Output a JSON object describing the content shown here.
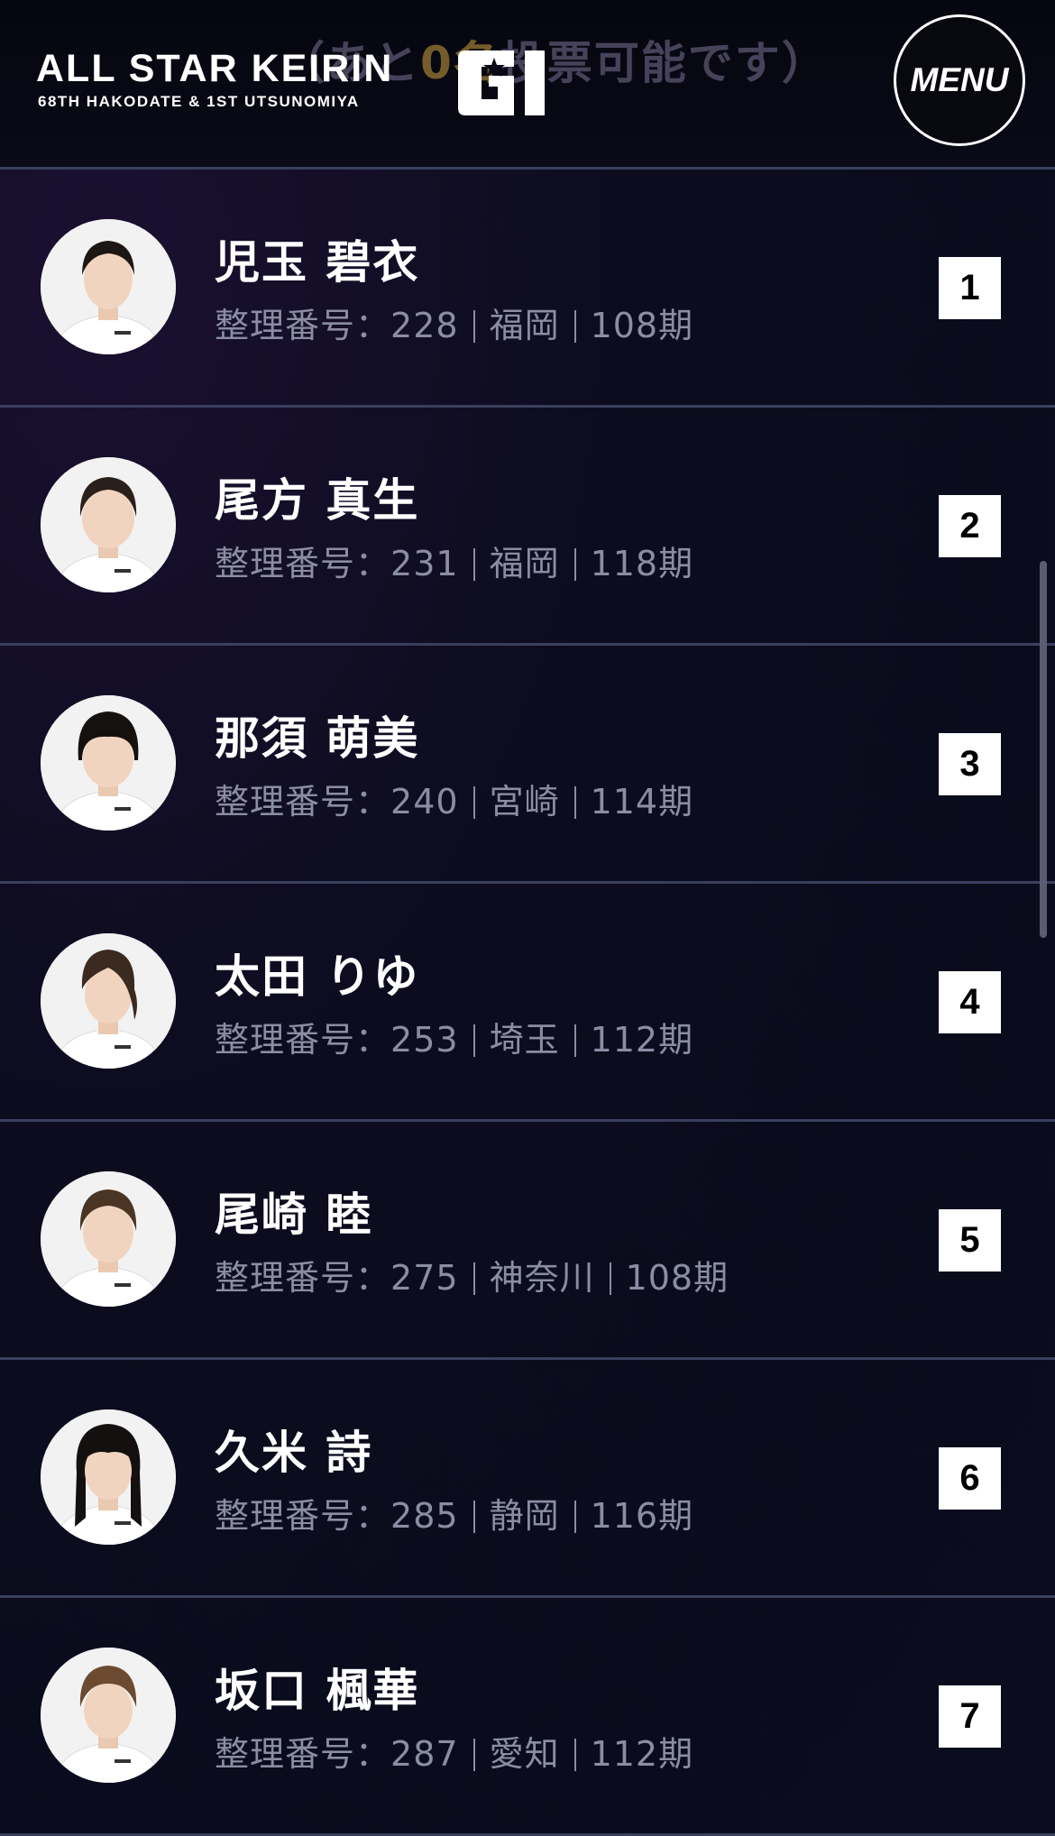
{
  "header": {
    "logo_title": "ALL STAR KEIRIN",
    "logo_subtitle": "68TH HAKODATE & 1ST UTSUNOMIYA",
    "grade_badge": "GI",
    "menu_label": "MENU",
    "behind_text_pre": "（あと",
    "behind_text_highlight": "0名",
    "behind_text_post": "投票可能です）"
  },
  "riders": [
    {
      "name": "児玉 碧衣",
      "reg_label": "整理番号",
      "reg_no": "228",
      "prefecture": "福岡",
      "term": "108期",
      "rank": "1"
    },
    {
      "name": "尾方 真生",
      "reg_label": "整理番号",
      "reg_no": "231",
      "prefecture": "福岡",
      "term": "118期",
      "rank": "2"
    },
    {
      "name": "那須 萌美",
      "reg_label": "整理番号",
      "reg_no": "240",
      "prefecture": "宮崎",
      "term": "114期",
      "rank": "3"
    },
    {
      "name": "太田 りゆ",
      "reg_label": "整理番号",
      "reg_no": "253",
      "prefecture": "埼玉",
      "term": "112期",
      "rank": "4"
    },
    {
      "name": "尾崎 睦",
      "reg_label": "整理番号",
      "reg_no": "275",
      "prefecture": "神奈川",
      "term": "108期",
      "rank": "5"
    },
    {
      "name": "久米 詩",
      "reg_label": "整理番号",
      "reg_no": "285",
      "prefecture": "静岡",
      "term": "116期",
      "rank": "6"
    },
    {
      "name": "坂口 楓華",
      "reg_label": "整理番号",
      "reg_no": "287",
      "prefecture": "愛知",
      "term": "112期",
      "rank": "7"
    }
  ],
  "colors": {
    "background": "#0b0c1f",
    "divider": "#3a3f5e",
    "meta_text": "#8a8da3",
    "rank_bg": "#ffffff",
    "rank_text": "#000000"
  },
  "icons": {
    "menu": "menu-button-circle",
    "grade": "gi-grade-badge",
    "avatar": "rider-photo"
  }
}
